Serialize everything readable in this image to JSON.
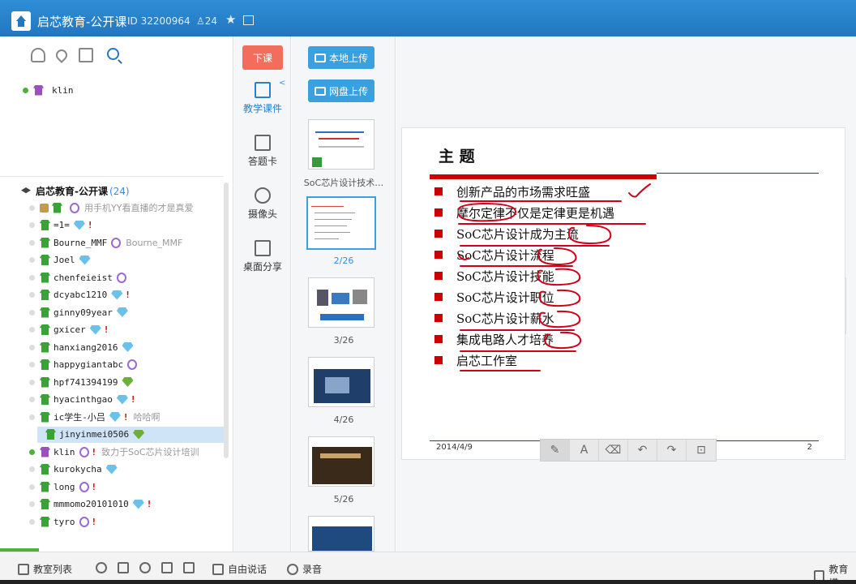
{
  "window": {
    "title": "启芯教育-公开课",
    "room_id": "ID 32200964",
    "user_count": "24"
  },
  "left_panel": {
    "teacher": {
      "name": "klin"
    },
    "group": {
      "name": "启芯教育-公开课",
      "count": "(24)"
    },
    "users": [
      {
        "name": "",
        "message": "用手机YY看直播的才是真爱",
        "role": "brown",
        "badge": "mic"
      },
      {
        "name": "=1=",
        "message": "",
        "role": "green",
        "badge": "gem",
        "mark": "!"
      },
      {
        "name": "Bourne_MMF",
        "message": "Bourne_MMF",
        "role": "green",
        "badge": "mic"
      },
      {
        "name": "Joel",
        "message": "",
        "role": "green",
        "badge": "gem"
      },
      {
        "name": "chenfeieist",
        "message": "",
        "role": "green",
        "badge": "mic"
      },
      {
        "name": "dcyabc1210",
        "message": "",
        "role": "green",
        "badge": "gem",
        "mark": "!"
      },
      {
        "name": "ginny09year",
        "message": "",
        "role": "green",
        "badge": "gem"
      },
      {
        "name": "gxicer",
        "message": "",
        "role": "green",
        "badge": "gem",
        "mark": "!"
      },
      {
        "name": "hanxiang2016",
        "message": "",
        "role": "green",
        "badge": "gem"
      },
      {
        "name": "happygiantabc",
        "message": "",
        "role": "green",
        "badge": "mic"
      },
      {
        "name": "hpf741394199",
        "message": "",
        "role": "green",
        "badge": "gem-green"
      },
      {
        "name": "hyacinthgao",
        "message": "",
        "role": "green",
        "badge": "gem",
        "mark": "!"
      },
      {
        "name": "ic学生-小吕",
        "message": "哈哈啊",
        "role": "green",
        "badge": "gem",
        "mark": "!"
      },
      {
        "name": "jinyinmei0506",
        "message": "",
        "role": "green",
        "badge": "gem-green",
        "selected": true
      },
      {
        "name": "klin",
        "message": "致力于SoC芯片设计培训",
        "role": "purple",
        "badge": "mic",
        "mark": "!"
      },
      {
        "name": "kurokycha",
        "message": "",
        "role": "green",
        "badge": "gem"
      },
      {
        "name": "long",
        "message": "",
        "role": "green",
        "badge": "mic",
        "mark": "!"
      },
      {
        "name": "mmmomo20101010",
        "message": "",
        "role": "green",
        "badge": "gem",
        "mark": "!"
      },
      {
        "name": "tyro",
        "message": "",
        "role": "green",
        "badge": "mic",
        "mark": "!"
      }
    ]
  },
  "tool_column": {
    "end_class": "下课",
    "items": [
      "教学课件",
      "答题卡",
      "摄像头",
      "桌面分享"
    ],
    "collapse": "<"
  },
  "strip": {
    "local_upload": "本地上传",
    "cloud_upload": "网盘上传",
    "thumbnails": [
      {
        "caption": "SoC芯片设计技术…"
      },
      {
        "caption": "2/26"
      },
      {
        "caption": "3/26"
      },
      {
        "caption": "4/26"
      },
      {
        "caption": "5/26"
      }
    ]
  },
  "slide": {
    "heading": "主 题",
    "bullets": [
      "创新产品的市场需求旺盛",
      "摩尔定律不仅是定律更是机遇",
      "SoC芯片设计成为主流",
      "SoC芯片设计流程",
      "SoC芯片设计技能",
      "SoC芯片设计职位",
      "SoC芯片设计薪水",
      "集成电路人才培养",
      "启芯工作室"
    ],
    "date": "2014/4/9",
    "page": "2"
  },
  "draw_tools": [
    "brush",
    "text",
    "eraser",
    "undo",
    "redo",
    "lock"
  ],
  "bottom_bar": {
    "classroom_list": "教室列表",
    "free_talk": "自由说话",
    "record": "录音",
    "right_label": "教育模"
  },
  "colors": {
    "titlebar": "#2276bf",
    "end_class_btn": "#f26d5b",
    "upload_btn": "#3aa0e0",
    "accent_red": "#cc0000"
  }
}
